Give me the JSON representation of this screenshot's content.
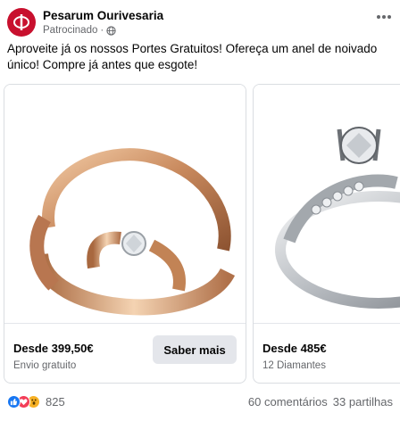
{
  "post": {
    "page_name": "Pesarum Ourivesaria",
    "sponsored_label": "Patrocinado",
    "separator": "·",
    "text": "Aproveite já os nossos Portes Gratuitos! Ofereça um anel de noivado único! Compre já antes que esgote!"
  },
  "carousel": {
    "cards": [
      {
        "title": "Desde 399,50€",
        "subtitle": "Envio gratuito",
        "cta": "Saber mais",
        "image": "rose-gold-solitaire-ring"
      },
      {
        "title": "Desde 485€",
        "subtitle": "12 Diamantes",
        "image": "white-gold-diamond-ring"
      }
    ]
  },
  "engagement": {
    "reaction_count": "825",
    "comments": "60 comentários",
    "shares": "33 partilhas"
  },
  "colors": {
    "brand": "#c8102e",
    "like": "#1877f2",
    "love": "#f33e58",
    "wow": "#f7b125"
  },
  "icons": {
    "avatar": "pesarum-logo-icon",
    "globe": "globe-icon",
    "more": "more-options-icon"
  }
}
